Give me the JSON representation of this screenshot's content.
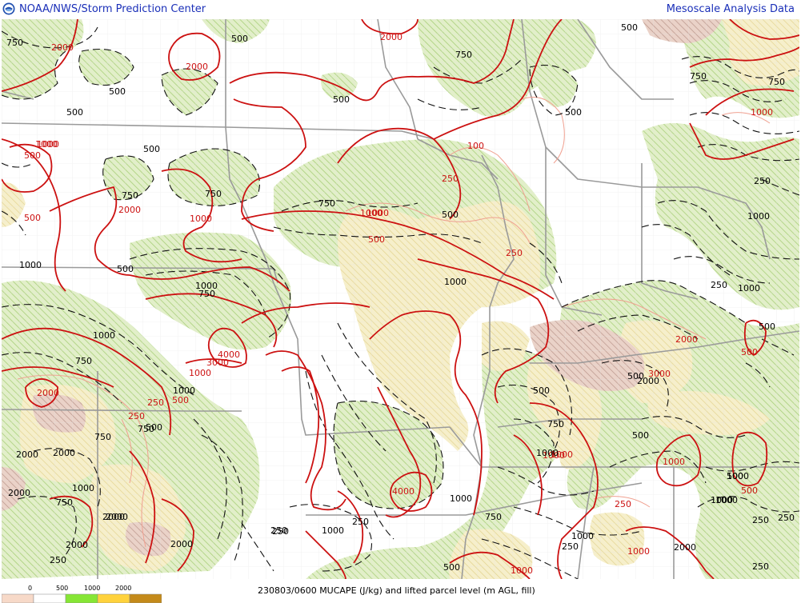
{
  "header": {
    "left_title": "NOAA/NWS/Storm Prediction Center",
    "right_title": "Mesoscale Analysis Data"
  },
  "caption": "230803/0600 MUCAPE (J/kg) and lifted parcel level (m AGL, fill)",
  "legend": {
    "ticks": [
      "0",
      "500",
      "1000",
      "2000"
    ],
    "colors": [
      "#f7d9c8",
      "#ffffff",
      "#86e635",
      "#ffd23c",
      "#c48a1a"
    ]
  },
  "colors": {
    "cape_contour": "#cc1111",
    "lpl_contour": "#111111",
    "lpl_thin": "#f0a090",
    "fill_green": "#cfe3a8",
    "fill_tan": "#f2e6b0",
    "fill_brown": "#d8b3a3",
    "state_border": "#9a9a9a",
    "county_border": "#d8d8d8"
  },
  "contour_labels": {
    "cape": [
      "2000",
      "2000",
      "2000",
      "1000",
      "500",
      "2000",
      "1000",
      "4000",
      "3000",
      "1000",
      "2000",
      "500",
      "1000",
      "3000",
      "2000",
      "1000",
      "500",
      "1000",
      "100",
      "250",
      "500",
      "1000",
      "4000",
      "1000",
      "1000",
      "500",
      "1000",
      "250",
      "1000",
      "1000",
      "250",
      "250",
      "250",
      "500"
    ],
    "lpl": [
      "750",
      "500",
      "500",
      "500",
      "750",
      "500",
      "500",
      "750",
      "500",
      "750",
      "750",
      "1000",
      "500",
      "750",
      "500",
      "250",
      "1000",
      "1000",
      "750",
      "500",
      "750",
      "500",
      "1000",
      "1000",
      "1000",
      "250",
      "750",
      "500",
      "1000",
      "1000",
      "750",
      "250",
      "250",
      "750",
      "500",
      "2000",
      "2000",
      "2000",
      "250",
      "500",
      "750",
      "1000",
      "750",
      "1000",
      "500",
      "2000",
      "1000",
      "1000",
      "1000",
      "2000",
      "250",
      "500",
      "2000",
      "2000",
      "500",
      "250",
      "1000",
      "750",
      "250",
      "2000",
      "1000",
      "250",
      "250",
      "2000"
    ]
  }
}
